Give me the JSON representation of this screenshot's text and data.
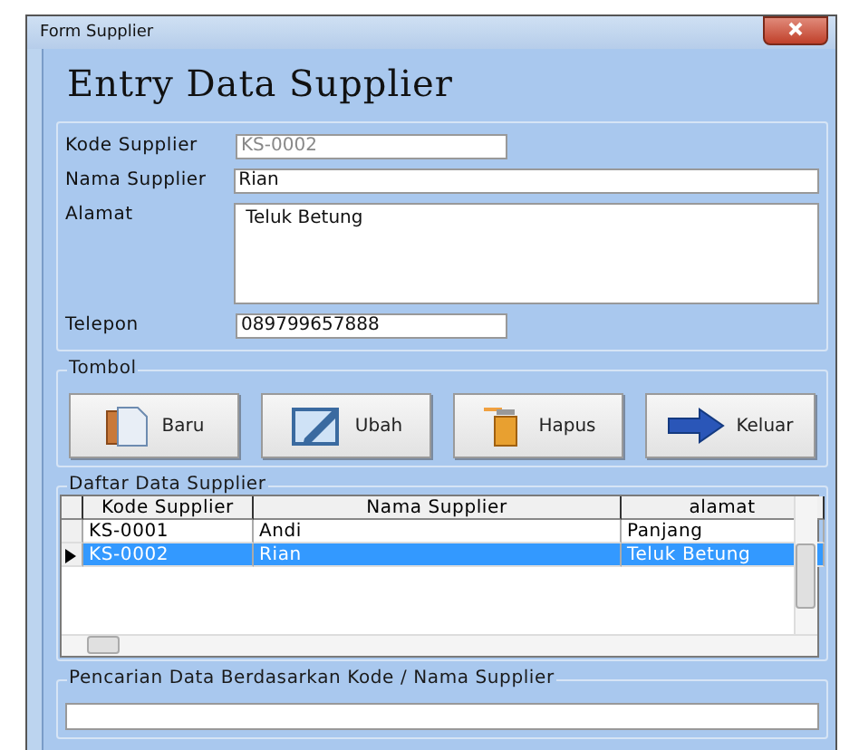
{
  "window": {
    "title": "Form Supplier"
  },
  "heading": "Entry Data Supplier",
  "fields": [
    {
      "label": "Kode Supplier",
      "value": "KS-0002",
      "kind": "short",
      "disabled": true
    },
    {
      "label": "Nama Supplier",
      "value": "Rian",
      "kind": "wide",
      "disabled": false
    },
    {
      "label": "Alamat",
      "value": "Teluk Betung",
      "kind": "multiline",
      "disabled": false
    },
    {
      "label": "Telepon",
      "value": "089799657888",
      "kind": "short",
      "disabled": false
    }
  ],
  "button_group": {
    "title": "Tombol",
    "buttons": [
      {
        "label": "Baru",
        "kind": "new"
      },
      {
        "label": "Ubah",
        "kind": "edit"
      },
      {
        "label": "Hapus",
        "kind": "delete"
      },
      {
        "label": "Keluar",
        "kind": "exit"
      }
    ]
  },
  "list": {
    "title": "Daftar Data Supplier",
    "columns": [
      "Kode Supplier",
      "Nama Supplier",
      "alamat"
    ],
    "rows": [
      {
        "cells": [
          "KS-0001",
          "Andi",
          "Panjang"
        ],
        "selected": false
      },
      {
        "cells": [
          "KS-0002",
          "Rian",
          "Teluk Betung"
        ],
        "selected": true
      }
    ]
  },
  "search": {
    "title": "Pencarian Data Berdasarkan Kode / Nama Supplier"
  }
}
